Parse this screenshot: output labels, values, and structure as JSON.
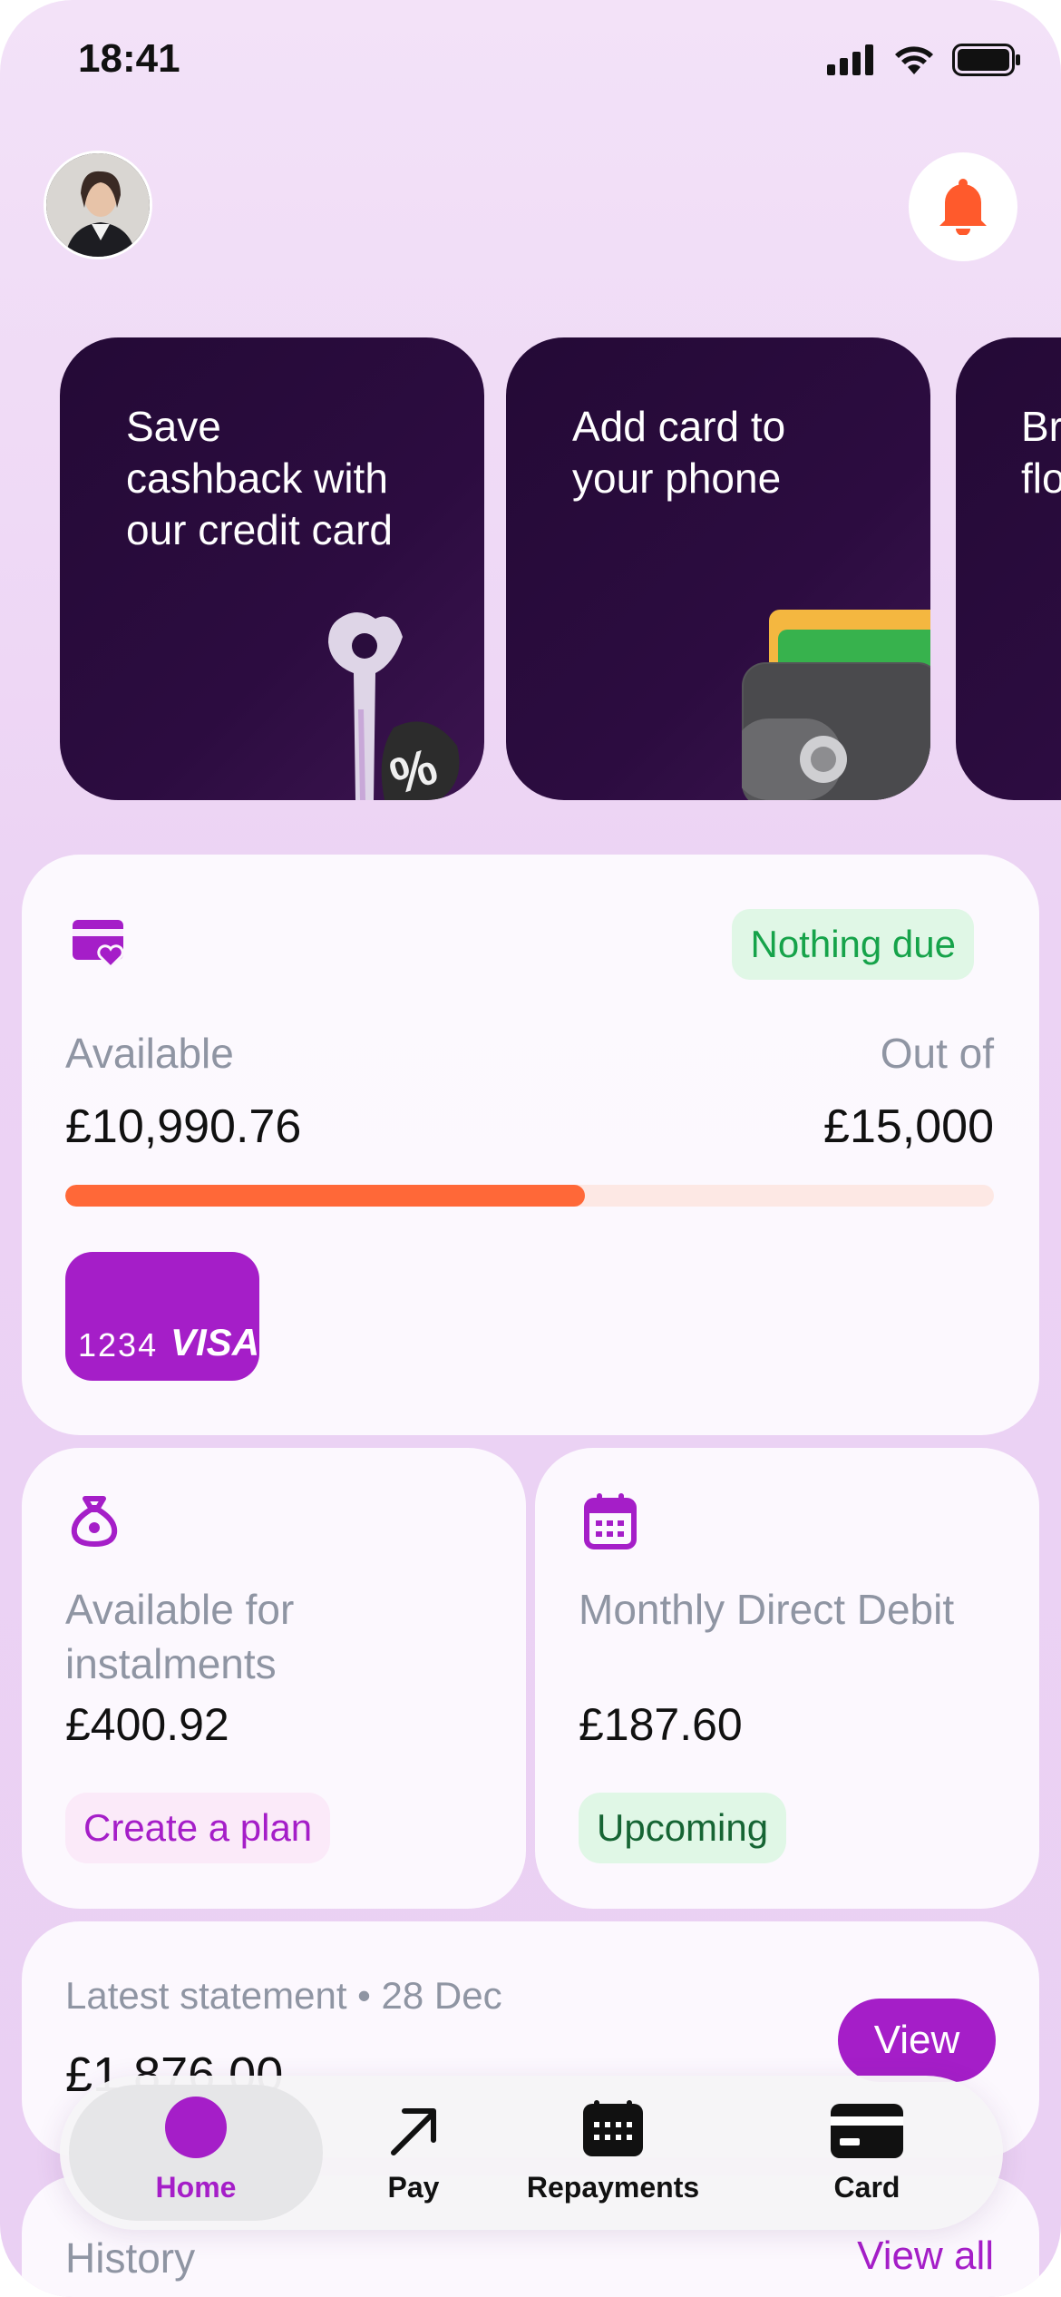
{
  "status": {
    "time": "18:41"
  },
  "promos": [
    {
      "text": "Save cashback with our credit card"
    },
    {
      "text": "Add card to your phone"
    },
    {
      "text": "Br flo"
    }
  ],
  "credit": {
    "badge": "Nothing due",
    "available_label": "Available",
    "available_amount": "£10,990.76",
    "outof_label": "Out of",
    "outof_amount": "£15,000",
    "progress_fraction": 0.56,
    "card_number": "1234",
    "card_brand": "VISA"
  },
  "instalments": {
    "label": "Available for instalments",
    "amount": "£400.92",
    "action": "Create a plan"
  },
  "direct_debit": {
    "label": "Monthly Direct Debit",
    "amount": "£187.60",
    "status": "Upcoming"
  },
  "statement": {
    "label": "Latest statement • 28 Dec",
    "amount": "£1,876.00",
    "button": "View"
  },
  "history": {
    "title": "History",
    "link": "View all"
  },
  "nav": {
    "home": "Home",
    "pay": "Pay",
    "repayments": "Repayments",
    "card": "Card"
  },
  "colors": {
    "accent": "#a51ec8",
    "progress": "#ff6838",
    "success": "#16a34a",
    "promo_bg": "#240a36"
  }
}
